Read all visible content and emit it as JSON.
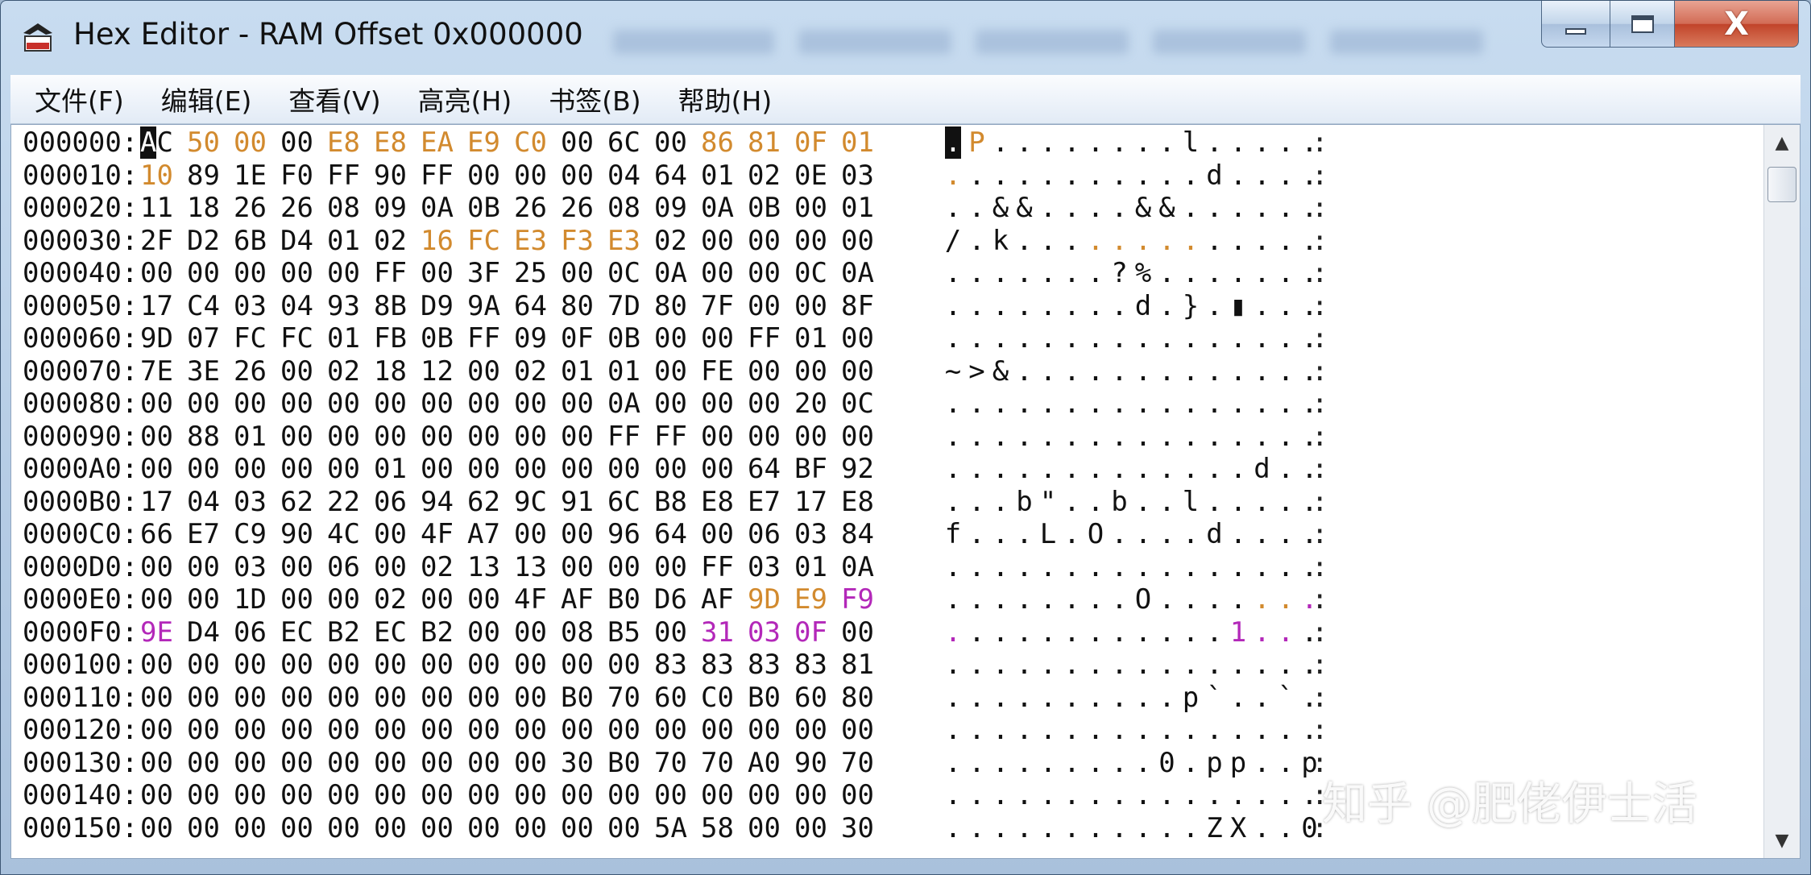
{
  "window": {
    "title": "Hex Editor - RAM Offset 0x000000",
    "icon": "editor-app-icon",
    "close_label": "X"
  },
  "menu": [
    {
      "label": "文件(F)"
    },
    {
      "label": "编辑(E)"
    },
    {
      "label": "查看(V)"
    },
    {
      "label": "高亮(H)"
    },
    {
      "label": "书签(B)"
    },
    {
      "label": "帮助(H)"
    }
  ],
  "colors": {
    "normal": "#111111",
    "highlight_orange": "#d28a2e",
    "highlight_purple": "#b328b9"
  },
  "separator": ":",
  "cursor": {
    "row": 0,
    "byte": 0
  },
  "rows": [
    {
      "addr": "000000:",
      "bytes": [
        "AC",
        "50",
        "00",
        "00",
        "E8",
        "E8",
        "EA",
        "E9",
        "C0",
        "00",
        "6C",
        "00",
        "86",
        "81",
        "0F",
        "01"
      ],
      "colors": "noonooooonnnoooo",
      "ascii": ".P........l.....",
      "ascii_colors": "nonnnnnnnnnnnnnn"
    },
    {
      "addr": "000010:",
      "bytes": [
        "10",
        "89",
        "1E",
        "F0",
        "FF",
        "90",
        "FF",
        "00",
        "00",
        "00",
        "04",
        "64",
        "01",
        "02",
        "0E",
        "03"
      ],
      "colors": "onnnnnnnnnnnnnnn",
      "ascii": "...........d....",
      "ascii_colors": "onnnnnnnnnnnnnnn"
    },
    {
      "addr": "000020:",
      "bytes": [
        "11",
        "18",
        "26",
        "26",
        "08",
        "09",
        "0A",
        "0B",
        "26",
        "26",
        "08",
        "09",
        "0A",
        "0B",
        "00",
        "01"
      ],
      "colors": "nnnnnnnnnnnnnnnn",
      "ascii": "..&&....&&......",
      "ascii_colors": "nnnnnnnnnnnnnnnn"
    },
    {
      "addr": "000030:",
      "bytes": [
        "2F",
        "D2",
        "6B",
        "D4",
        "01",
        "02",
        "16",
        "FC",
        "E3",
        "F3",
        "E3",
        "02",
        "00",
        "00",
        "00",
        "00"
      ],
      "colors": "nnnnnnooooonnnnn",
      "ascii": "/.k.............",
      "ascii_colors": "nnnnnnooooonnnnn"
    },
    {
      "addr": "000040:",
      "bytes": [
        "00",
        "00",
        "00",
        "00",
        "00",
        "FF",
        "00",
        "3F",
        "25",
        "00",
        "0C",
        "0A",
        "00",
        "00",
        "0C",
        "0A"
      ],
      "colors": "nnnnnnnnnnnnnnnn",
      "ascii": ".......?%.......",
      "ascii_colors": "nnnnnnnnnnnnnnnn"
    },
    {
      "addr": "000050:",
      "bytes": [
        "17",
        "C4",
        "03",
        "04",
        "93",
        "8B",
        "D9",
        "9A",
        "64",
        "80",
        "7D",
        "80",
        "7F",
        "00",
        "00",
        "8F"
      ],
      "colors": "nnnnnnnnnnnnnnnn",
      "ascii": "........d.}.▮...",
      "ascii_colors": "nnnnnnnnnnnnnnnn"
    },
    {
      "addr": "000060:",
      "bytes": [
        "9D",
        "07",
        "FC",
        "FC",
        "01",
        "FB",
        "0B",
        "FF",
        "09",
        "0F",
        "0B",
        "00",
        "00",
        "FF",
        "01",
        "00"
      ],
      "colors": "nnnnnnnnnnnnnnnn",
      "ascii": "................",
      "ascii_colors": "nnnnnnnnnnnnnnnn"
    },
    {
      "addr": "000070:",
      "bytes": [
        "7E",
        "3E",
        "26",
        "00",
        "02",
        "18",
        "12",
        "00",
        "02",
        "01",
        "01",
        "00",
        "FE",
        "00",
        "00",
        "00"
      ],
      "colors": "nnnnnnnnnnnnnnnn",
      "ascii": "~>&.............",
      "ascii_colors": "nnnnnnnnnnnnnnnn"
    },
    {
      "addr": "000080:",
      "bytes": [
        "00",
        "00",
        "00",
        "00",
        "00",
        "00",
        "00",
        "00",
        "00",
        "00",
        "0A",
        "00",
        "00",
        "00",
        "20",
        "0C",
        "0C"
      ],
      "colors": "nnnnnnnnnnnnnnnnn",
      "ascii": "................",
      "ascii_colors": "nnnnnnnnnnnnnnnn"
    },
    {
      "addr": "000090:",
      "bytes": [
        "00",
        "88",
        "01",
        "00",
        "00",
        "00",
        "00",
        "00",
        "00",
        "00",
        "FF",
        "FF",
        "00",
        "00",
        "00",
        "00"
      ],
      "colors": "nnnnnnnnnnnnnnnn",
      "ascii": "................",
      "ascii_colors": "nnnnnnnnnnnnnnnn"
    },
    {
      "addr": "0000A0:",
      "bytes": [
        "00",
        "00",
        "00",
        "00",
        "00",
        "01",
        "00",
        "00",
        "00",
        "00",
        "00",
        "00",
        "00",
        "64",
        "BF",
        "92"
      ],
      "colors": "nnnnnnnnnnnnnnnn",
      "ascii": ".............d..",
      "ascii_colors": "nnnnnnnnnnnnnnnn"
    },
    {
      "addr": "0000B0:",
      "bytes": [
        "17",
        "04",
        "03",
        "62",
        "22",
        "06",
        "94",
        "62",
        "9C",
        "91",
        "6C",
        "B8",
        "E8",
        "E7",
        "17",
        "E8"
      ],
      "colors": "nnnnnnnnnnnnnnnn",
      "ascii": "...b\"..b..l.....",
      "ascii_colors": "nnnnnnnnnnnnnnnn"
    },
    {
      "addr": "0000C0:",
      "bytes": [
        "66",
        "E7",
        "C9",
        "90",
        "4C",
        "00",
        "4F",
        "A7",
        "00",
        "00",
        "96",
        "64",
        "00",
        "06",
        "03",
        "84"
      ],
      "colors": "nnnnnnnnnnnnnnnn",
      "ascii": "f...L.O....d....",
      "ascii_colors": "nnnnnnnnnnnnnnnn"
    },
    {
      "addr": "0000D0:",
      "bytes": [
        "00",
        "00",
        "03",
        "00",
        "06",
        "00",
        "02",
        "13",
        "13",
        "00",
        "00",
        "00",
        "FF",
        "03",
        "01",
        "0A"
      ],
      "colors": "nnnnnnnnnnnnnnnn",
      "ascii": "................",
      "ascii_colors": "nnnnnnnnnnnnnnnn"
    },
    {
      "addr": "0000E0:",
      "bytes": [
        "00",
        "00",
        "1D",
        "00",
        "00",
        "02",
        "00",
        "00",
        "4F",
        "AF",
        "B0",
        "D6",
        "AF",
        "9D",
        "E9",
        "F9"
      ],
      "colors": "nnnnnnnnnnnnnoop",
      "ascii": "........O.......",
      "ascii_colors": "nnnnnnnnnnnnnoop"
    },
    {
      "addr": "0000F0:",
      "bytes": [
        "9E",
        "D4",
        "06",
        "EC",
        "B2",
        "EC",
        "B2",
        "00",
        "00",
        "08",
        "B5",
        "00",
        "31",
        "03",
        "0F",
        "00"
      ],
      "colors": "pnnnnnnnnnnnpppn",
      "ascii": "............1...",
      "ascii_colors": "pnnnnnnnnnnnpppn"
    },
    {
      "addr": "000100:",
      "bytes": [
        "00",
        "00",
        "00",
        "00",
        "00",
        "00",
        "00",
        "00",
        "00",
        "00",
        "00",
        "83",
        "83",
        "83",
        "83",
        "81"
      ],
      "colors": "nnnnnnnnnnnnnnnn",
      "ascii": "................",
      "ascii_colors": "nnnnnnnnnnnnnnnn"
    },
    {
      "addr": "000110:",
      "bytes": [
        "00",
        "00",
        "00",
        "00",
        "00",
        "00",
        "00",
        "00",
        "00",
        "B0",
        "70",
        "60",
        "C0",
        "B0",
        "60",
        "80"
      ],
      "colors": "nnnnnnnnnnnnnnnn",
      "ascii": "..........p`..`.",
      "ascii_colors": "nnnnnnnnnnnnnnnn"
    },
    {
      "addr": "000120:",
      "bytes": [
        "00",
        "00",
        "00",
        "00",
        "00",
        "00",
        "00",
        "00",
        "00",
        "00",
        "00",
        "00",
        "00",
        "00",
        "00",
        "00"
      ],
      "colors": "nnnnnnnnnnnnnnnn",
      "ascii": "................",
      "ascii_colors": "nnnnnnnnnnnnnnnn"
    },
    {
      "addr": "000130:",
      "bytes": [
        "00",
        "00",
        "00",
        "00",
        "00",
        "00",
        "00",
        "00",
        "00",
        "30",
        "B0",
        "70",
        "70",
        "A0",
        "90",
        "70"
      ],
      "colors": "nnnnnnnnnnnnnnnn",
      "ascii": ".........0.pp..p",
      "ascii_colors": "nnnnnnnnnnnnnnnn"
    },
    {
      "addr": "000140:",
      "bytes": [
        "00",
        "00",
        "00",
        "00",
        "00",
        "00",
        "00",
        "00",
        "00",
        "00",
        "00",
        "00",
        "00",
        "00",
        "00",
        "00"
      ],
      "colors": "nnnnnnnnnnnnnnnn",
      "ascii": "................",
      "ascii_colors": "nnnnnnnnnnnnnnnn"
    },
    {
      "addr": "000150:",
      "bytes": [
        "00",
        "00",
        "00",
        "00",
        "00",
        "00",
        "00",
        "00",
        "00",
        "00",
        "00",
        "5A",
        "58",
        "00",
        "00",
        "30"
      ],
      "colors": "nnnnnnnnnnnnnnnn",
      "ascii": "...........ZX..0",
      "ascii_colors": "nnnnnnnnnnnnnnnn"
    }
  ],
  "watermark": "知乎 @肥佬伊士活"
}
